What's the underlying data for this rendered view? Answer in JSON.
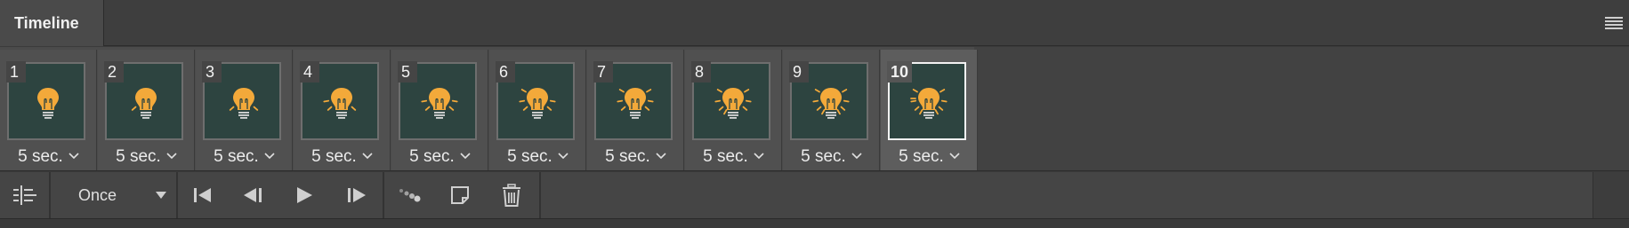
{
  "panel": {
    "title": "Timeline",
    "menu_icon": "hamburger-menu-icon"
  },
  "frames": [
    {
      "number": "1",
      "delay": "5 sec.",
      "rays": 0
    },
    {
      "number": "2",
      "delay": "5 sec.",
      "rays": 1
    },
    {
      "number": "3",
      "delay": "5 sec.",
      "rays": 2
    },
    {
      "number": "4",
      "delay": "5 sec.",
      "rays": 3
    },
    {
      "number": "5",
      "delay": "5 sec.",
      "rays": 4
    },
    {
      "number": "6",
      "delay": "5 sec.",
      "rays": 5
    },
    {
      "number": "7",
      "delay": "5 sec.",
      "rays": 6
    },
    {
      "number": "8",
      "delay": "5 sec.",
      "rays": 7
    },
    {
      "number": "9",
      "delay": "5 sec.",
      "rays": 8
    },
    {
      "number": "10",
      "delay": "5 sec.",
      "rays": 9
    }
  ],
  "selected_frame": "10",
  "toolbar": {
    "loop_option": "Once",
    "buttons": [
      "convert-to-video-timeline-icon",
      "first-frame-icon",
      "previous-frame-icon",
      "play-icon",
      "next-frame-icon",
      "tween-icon",
      "duplicate-frame-icon",
      "delete-frame-icon"
    ]
  },
  "colors": {
    "thumb_bg": "#2d4440",
    "bulb": "#f3a93a",
    "selected_border": "#f2f2f2"
  }
}
